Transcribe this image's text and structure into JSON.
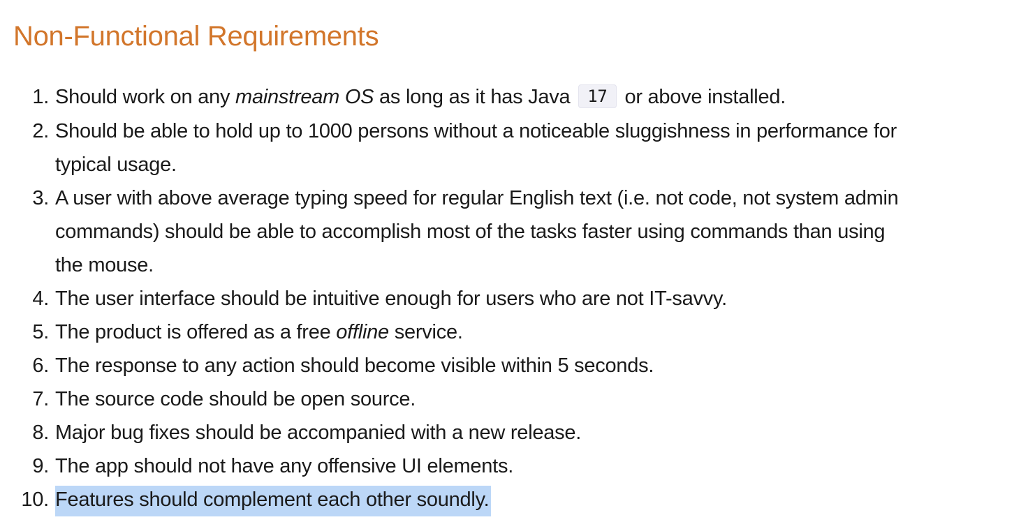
{
  "heading": "Non-Functional Requirements",
  "items": [
    {
      "number": "1.",
      "before": "Should work on any ",
      "emphasis": "mainstream OS",
      "middle": " as long as it has Java ",
      "code": "17",
      "after": " or above installed."
    },
    {
      "number": "2.",
      "line1": "Should be able to hold up to 1000 persons without a noticeable sluggishness in performance for",
      "line2": "typical usage."
    },
    {
      "number": "3.",
      "line1": "A user with above average typing speed for regular English text (i.e. not code, not system admin",
      "line2": "commands) should be able to accomplish most of the tasks faster using commands than using",
      "line3": "the mouse."
    },
    {
      "number": "4.",
      "text": "The user interface should be intuitive enough for users who are not IT-savvy."
    },
    {
      "number": "5.",
      "before": "The product is offered as a free ",
      "emphasis": "offline",
      "after": " service."
    },
    {
      "number": "6.",
      "text": "The response to any action should become visible within 5 seconds."
    },
    {
      "number": "7.",
      "text": "The source code should be open source."
    },
    {
      "number": "8.",
      "text": "Major bug fixes should be accompanied with a new release."
    },
    {
      "number": "9.",
      "text": "The app should not have any offensive UI elements."
    },
    {
      "number": "10.",
      "text": "Features should complement each other soundly."
    }
  ],
  "colors": {
    "heading": "#d2762b",
    "text": "#1a1a1a",
    "selection_highlight": "#bcd7f7",
    "code_background": "#f1f1f7"
  }
}
